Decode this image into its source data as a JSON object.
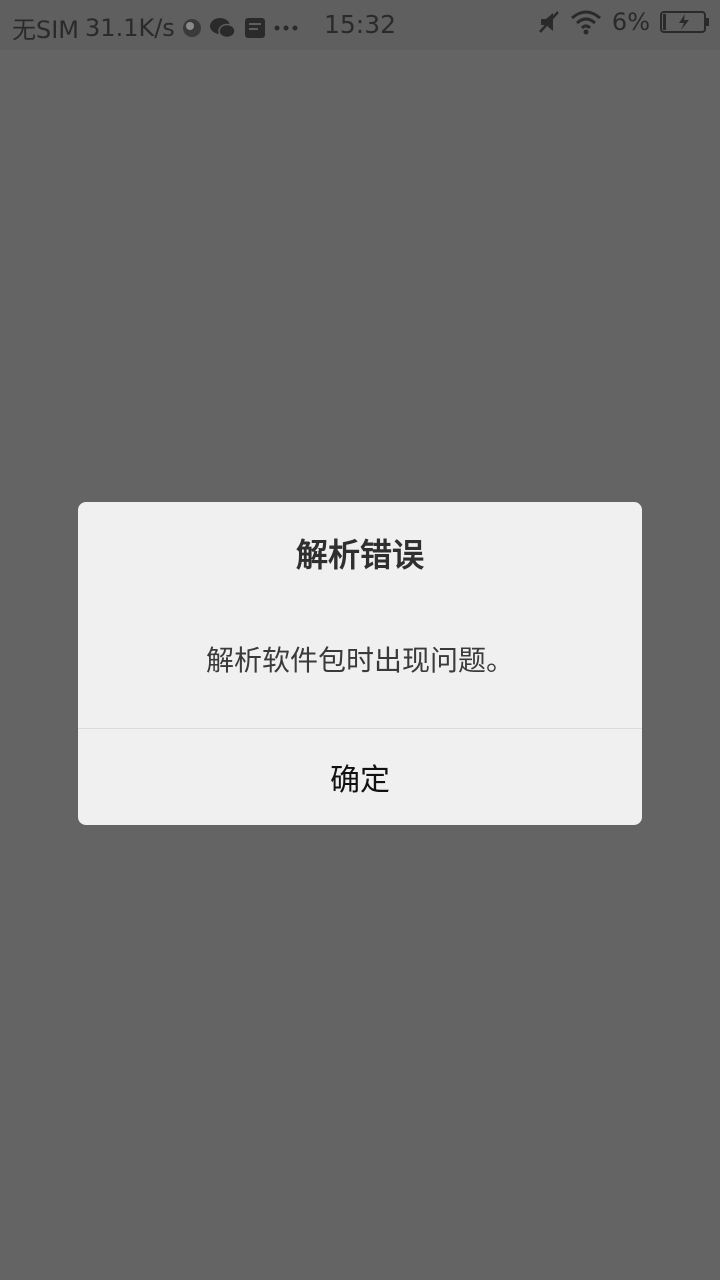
{
  "status_bar": {
    "sim": "无SIM",
    "speed": "31.1K/s",
    "time": "15:32",
    "battery": "6%",
    "icons": [
      "app-icon",
      "wechat-icon",
      "app-icon-2",
      "more-dots-icon",
      "mute-icon",
      "wifi-icon",
      "battery-charging-icon"
    ]
  },
  "dialog": {
    "title": "解析错误",
    "message": "解析软件包时出现问题。",
    "confirm_label": "确定"
  },
  "colors": {
    "overlay": "#646464",
    "dialog_bg": "#f0f0f0",
    "divider": "#dcdcdc"
  }
}
